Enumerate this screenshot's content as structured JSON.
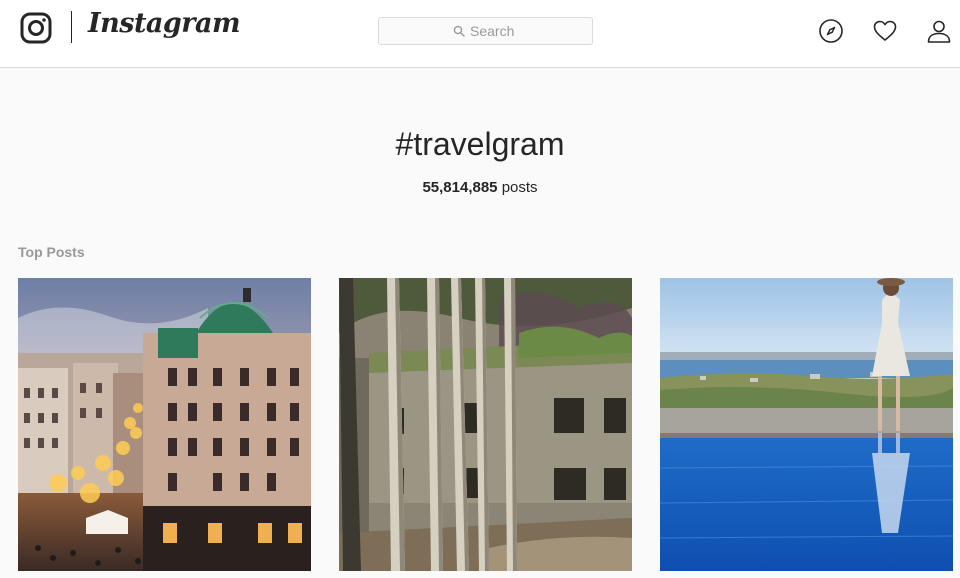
{
  "header": {
    "brand": "Instagram",
    "search": {
      "placeholder": "Search",
      "value": ""
    },
    "nav": [
      "compass-icon",
      "heart-icon",
      "person-icon"
    ]
  },
  "hashtag": {
    "title": "#travelgram",
    "post_count": "55,814,885",
    "post_count_label": "posts"
  },
  "sections": {
    "top_posts": "Top Posts"
  },
  "posts": [
    {
      "description_icon": "city-building-image"
    },
    {
      "description_icon": "ruined-building-forest-image"
    },
    {
      "description_icon": "woman-by-pool-image"
    }
  ],
  "colors": {
    "text": "#262626",
    "muted": "#999999",
    "border": "#dbdbdb",
    "background": "#fafafa"
  }
}
